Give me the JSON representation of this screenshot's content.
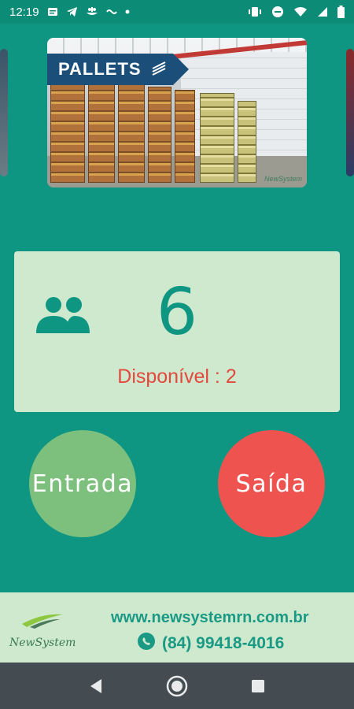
{
  "status_bar": {
    "time": "12:19",
    "icons_left": [
      "message-icon",
      "telegram-icon",
      "app-icon",
      "wave-icon",
      "dot-icon"
    ],
    "icons_right": [
      "vibrate-icon",
      "dnd-icon",
      "wifi-icon",
      "signal-icon",
      "battery-icon"
    ]
  },
  "carousel": {
    "banner_text": "PALLETS",
    "card_logo_text": "NewSystem"
  },
  "counter": {
    "value": "6",
    "available_text": "Disponível : 2",
    "icon": "people-icon",
    "count_color": "#0f9682",
    "available_color": "#e4483c"
  },
  "actions": {
    "entrada_label": "Entrada",
    "saida_label": "Saída",
    "entrada_color": "#7dc07d",
    "saida_color": "#ef5350"
  },
  "footer": {
    "logo_text": "NewSystem",
    "website": "www.newsystemrn.com.br",
    "phone": "(84) 99418-4016",
    "phone_icon": "whatsapp-icon"
  },
  "nav_bar": {
    "buttons": [
      "back-icon",
      "home-icon",
      "recents-icon"
    ]
  },
  "colors": {
    "background": "#0f9682",
    "panel": "#cfe9cf"
  }
}
